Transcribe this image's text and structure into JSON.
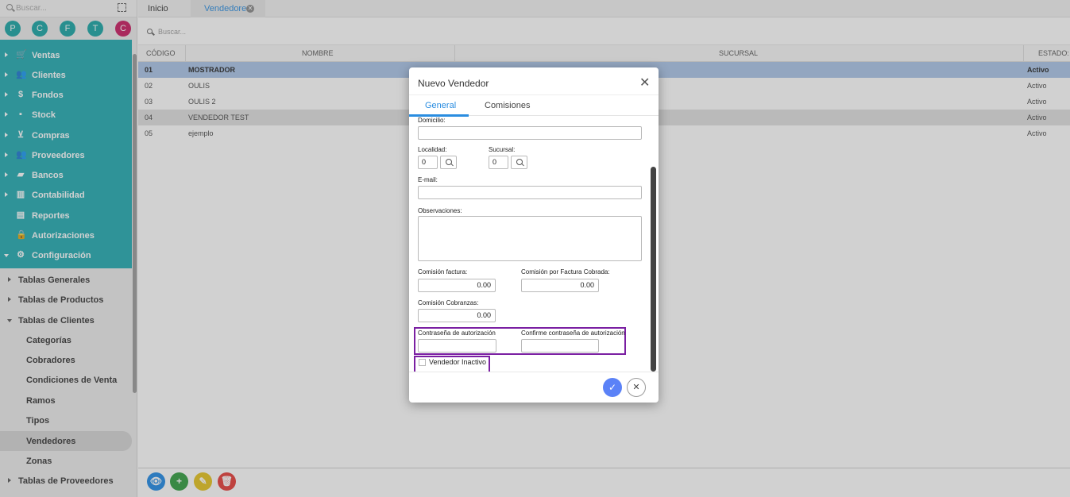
{
  "sidebar": {
    "search_placeholder": "Buscar...",
    "quick_circles": [
      "P",
      "C",
      "F",
      "T",
      "C"
    ],
    "menu": [
      {
        "label": "Ventas",
        "icon": "cart-icon",
        "glyph": "🛒"
      },
      {
        "label": "Clientes",
        "icon": "users-icon",
        "glyph": "👥"
      },
      {
        "label": "Fondos",
        "icon": "dollar-icon",
        "glyph": "$"
      },
      {
        "label": "Stock",
        "icon": "box-icon",
        "glyph": "▪"
      },
      {
        "label": "Compras",
        "icon": "basket-icon",
        "glyph": "⊻"
      },
      {
        "label": "Proveedores",
        "icon": "suppliers-icon",
        "glyph": "👥"
      },
      {
        "label": "Bancos",
        "icon": "briefcase-icon",
        "glyph": "▰"
      },
      {
        "label": "Contabilidad",
        "icon": "ledger-icon",
        "glyph": "▥"
      },
      {
        "label": "Reportes",
        "icon": "report-icon",
        "glyph": "▤"
      },
      {
        "label": "Autorizaciones",
        "icon": "lock-icon",
        "glyph": "🔒"
      },
      {
        "label": "Configuración",
        "icon": "gears-icon",
        "glyph": "⚙"
      }
    ],
    "groups": {
      "tablas_generales": "Tablas Generales",
      "tablas_productos": "Tablas de Productos",
      "tablas_clientes": "Tablas de Clientes",
      "tablas_proveedores": "Tablas de Proveedores"
    },
    "sub_items": [
      "Categorías",
      "Cobradores",
      "Condiciones de Venta",
      "Ramos",
      "Tipos",
      "Vendedores",
      "Zonas"
    ]
  },
  "tabs": {
    "inicio": "Inicio",
    "vendedores": "Vendedores",
    "close_glyph": "✕"
  },
  "grid": {
    "search_placeholder": "Buscar...",
    "columns": {
      "codigo": "CÓDIGO",
      "nombre": "NOMBRE",
      "sucursal": "SUCURSAL",
      "estado": "ESTADO:"
    },
    "rows": [
      {
        "codigo": "01",
        "nombre": "MOSTRADOR",
        "estado": "Activo"
      },
      {
        "codigo": "02",
        "nombre": "OULIS",
        "estado": "Activo"
      },
      {
        "codigo": "03",
        "nombre": "OULIS 2",
        "estado": "Activo"
      },
      {
        "codigo": "04",
        "nombre": "VENDEDOR TEST",
        "estado": "Activo"
      },
      {
        "codigo": "05",
        "nombre": "ejemplo",
        "estado": "Activo"
      }
    ]
  },
  "modal": {
    "title": "Nuevo Vendedor",
    "close_glyph": "✕",
    "tabs": {
      "general": "General",
      "comisiones": "Comisiones"
    },
    "fields": {
      "domicilio_label": "Domicilio:",
      "localidad_label": "Localidad:",
      "localidad_value": "0",
      "sucursal_label": "Sucursal:",
      "sucursal_value": "0",
      "email_label": "E-mail:",
      "observaciones_label": "Observaciones:",
      "comision_factura_label": "Comisión factura:",
      "comision_factura_value": "0.00",
      "comision_cobrada_label": "Comisión por Factura Cobrada:",
      "comision_cobrada_value": "0.00",
      "comision_cobranzas_label": "Comisión Cobranzas:",
      "comision_cobranzas_value": "0.00",
      "password_label": "Contraseña de autorización",
      "confirm_password_label": "Confirme contraseña de autorización",
      "inactive_label": "Vendedor Inactivo"
    },
    "ok_glyph": "✓",
    "cancel_glyph": "✕"
  },
  "footer_buttons": [
    {
      "name": "view-button",
      "glyph": "👁",
      "color": "#1e88e5"
    },
    {
      "name": "add-button",
      "glyph": "+",
      "color": "#2e9b3e"
    },
    {
      "name": "edit-button",
      "glyph": "✎",
      "color": "#e5c21b"
    },
    {
      "name": "delete-button",
      "glyph": "🗑",
      "color": "#e53935"
    }
  ]
}
